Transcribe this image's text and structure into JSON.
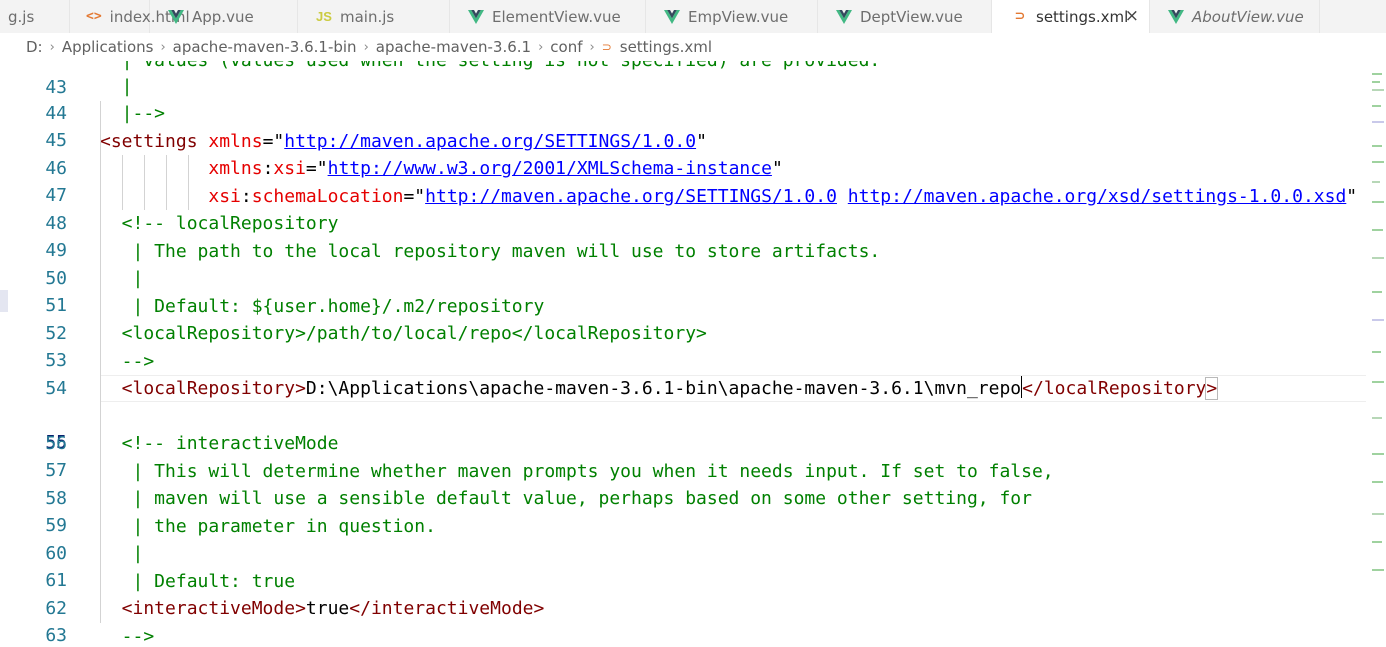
{
  "tabs": [
    {
      "label": "g.js",
      "icon": "js-icon",
      "active": false
    },
    {
      "label": "index.html",
      "icon": "html-icon",
      "active": false
    },
    {
      "label": "App.vue",
      "icon": "vue-icon",
      "active": false
    },
    {
      "label": "main.js",
      "icon": "js-icon",
      "active": false
    },
    {
      "label": "ElementView.vue",
      "icon": "vue-icon",
      "active": false
    },
    {
      "label": "EmpView.vue",
      "icon": "vue-icon",
      "active": false
    },
    {
      "label": "DeptView.vue",
      "icon": "vue-icon",
      "active": false
    },
    {
      "label": "settings.xml",
      "icon": "rss-icon",
      "active": true,
      "close": "×"
    },
    {
      "label": "AboutView.vue",
      "icon": "vue-icon",
      "active": false
    }
  ],
  "tab_icons": {
    "html": "<>",
    "js": "JS",
    "xml": "⊃"
  },
  "breadcrumb": {
    "parts": [
      "D:",
      "Applications",
      "apache-maven-3.6.1-bin",
      "apache-maven-3.6.1",
      "conf",
      "settings.xml"
    ],
    "separator": "›"
  },
  "editor": {
    "current_line": "55",
    "lines": [
      {
        "n": "43",
        "text": "  | values (values used when the setting is not specified) are provided."
      },
      {
        "n": "44",
        "text": "  |"
      },
      {
        "n": "45",
        "text": "  |-->"
      },
      {
        "n": "46",
        "p": [
          "<settings ",
          "xmlns",
          "=",
          "\"",
          "http://maven.apache.org/SETTINGS/1.0.0",
          "\""
        ]
      },
      {
        "n": "47",
        "p": [
          "          ",
          "xmlns",
          "xsi",
          "=",
          "\"",
          "http://www.w3.org/2001/XMLSchema-instance",
          "\""
        ]
      },
      {
        "n": "48",
        "p": [
          "          ",
          "xsi",
          "schemaLocation",
          "=",
          "\"",
          "http://maven.apache.org/SETTINGS/1.0.0",
          " ",
          "http://maven.apache.org/xsd/settings-1.0.0.xsd",
          "\""
        ]
      },
      {
        "n": "49",
        "text": "  <!-- localRepository"
      },
      {
        "n": "50",
        "text": "   | The path to the local repository maven will use to store artifacts."
      },
      {
        "n": "51",
        "text": "   |"
      },
      {
        "n": "52",
        "text": "   | Default: ${user.home}/.m2/repository"
      },
      {
        "n": "53",
        "text": "  <localRepository>/path/to/local/repo</localRepository>"
      },
      {
        "n": "54",
        "text": "  -->"
      },
      {
        "n": "55",
        "p": [
          "  <localRepository>",
          "D:\\Applications\\apache-maven-3.6.1-bin\\apache-maven-3.6.1\\mvn_repo",
          "</localRepository",
          ">"
        ]
      },
      {
        "n": "56",
        "text": ""
      },
      {
        "n": "57",
        "text": "  <!-- interactiveMode"
      },
      {
        "n": "58",
        "text": "   | This will determine whether maven prompts you when it needs input. If set to false,"
      },
      {
        "n": "59",
        "text": "   | maven will use a sensible default value, perhaps based on some other setting, for"
      },
      {
        "n": "60",
        "text": "   | the parameter in question."
      },
      {
        "n": "61",
        "text": "   |"
      },
      {
        "n": "62",
        "text": "   | Default: true"
      },
      {
        "n": "63",
        "p": [
          "  <interactiveMode>",
          "true",
          "</interactiveMode>"
        ]
      },
      {
        "n": "64",
        "text": "  -->"
      }
    ]
  },
  "colors": {
    "comment": "#008000",
    "tag": "#800000",
    "attribute": "#e50000",
    "string": "#0000ff",
    "line_number": "#237893",
    "active_line_number": "#0b216f"
  }
}
